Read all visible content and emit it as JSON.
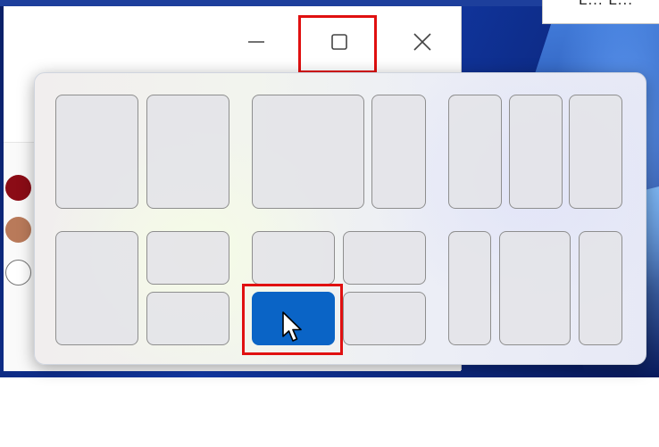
{
  "desktop": {
    "background_colors": [
      "#0a1f66",
      "#123aa8",
      "#6aa6ff"
    ],
    "app_fragment_text": "L... L..."
  },
  "window": {
    "caption_buttons": [
      {
        "name": "minimize",
        "icon": "minimize-icon"
      },
      {
        "name": "maximize",
        "icon": "maximize-icon",
        "highlighted": true
      },
      {
        "name": "close",
        "icon": "close-icon"
      }
    ],
    "color_swatches": [
      "#8b0c16",
      "#b97a5a",
      "#ffffff"
    ]
  },
  "snap_layouts": {
    "layouts": [
      {
        "name": "two-halves",
        "zones": 2
      },
      {
        "name": "wide-left-narrow-right",
        "zones": 2
      },
      {
        "name": "three-columns",
        "zones": 3
      },
      {
        "name": "left-half-right-stacked",
        "zones": 3
      },
      {
        "name": "four-quadrants",
        "zones": 4,
        "selected_zone": "bottom-left"
      },
      {
        "name": "narrow-wide-narrow",
        "zones": 3
      }
    ],
    "selected_color": "#0a64c6",
    "highlight_color": "#e01010"
  }
}
